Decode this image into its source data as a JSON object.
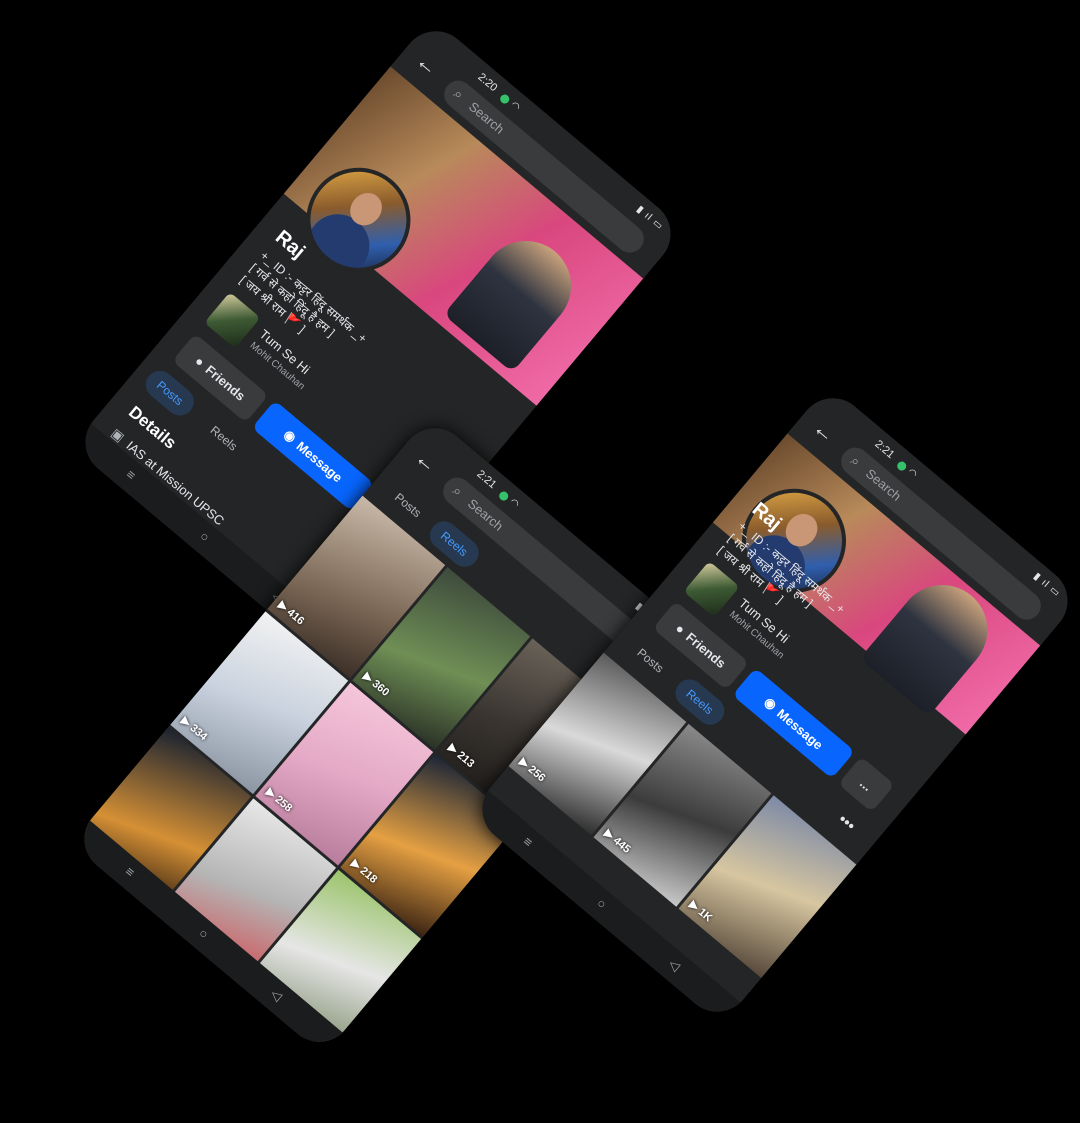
{
  "phones": {
    "profile": {
      "status": {
        "time": "2:20"
      },
      "search": {
        "placeholder": "Search"
      },
      "profile": {
        "name": "Raj",
        "bio": [
          "+_ ID :- कट्टर हिंदू समर्थक _+",
          "[ गर्व से कहो हिंदू है हम ]",
          "[ जय श्री राम 🚩 ]"
        ],
        "music": {
          "title": "Tum Se Hi",
          "artist": "Mohit Chauhan"
        }
      },
      "buttons": {
        "friends": "Friends",
        "message": "Message",
        "more": "..."
      },
      "tabs": {
        "posts": "Posts",
        "reels": "Reels"
      },
      "details": {
        "title": "Details",
        "work": "IAS at Mission UPSC"
      },
      "nav": {
        "menu": "≡",
        "home": "○",
        "back": "◁"
      }
    },
    "reels": {
      "status": {
        "time": "2:21"
      },
      "search": {
        "placeholder": "Search"
      },
      "tabs": {
        "posts": "Posts",
        "reels": "Reels"
      },
      "reels": [
        {
          "count": "416"
        },
        {
          "count": "360"
        },
        {
          "count": "213"
        },
        {
          "count": "334"
        },
        {
          "count": "258"
        },
        {
          "count": "218"
        }
      ],
      "nav": {
        "menu": "≡",
        "home": "○",
        "back": "◁"
      }
    },
    "profile_reels": {
      "status": {
        "time": "2:21"
      },
      "search": {
        "placeholder": "Search"
      },
      "profile": {
        "name": "Raj",
        "bio": [
          "+_ ID :- कट्टर हिंदू समर्थक _+",
          "[ गर्व से कहो हिंदू है हम ]",
          "[ जय श्री राम 🚩 ]"
        ],
        "music": {
          "title": "Tum Se Hi",
          "artist": "Mohit Chauhan"
        }
      },
      "buttons": {
        "friends": "Friends",
        "message": "Message",
        "more": "..."
      },
      "tabs": {
        "posts": "Posts",
        "reels": "Reels"
      },
      "reels": [
        {
          "count": "256"
        },
        {
          "count": "445"
        },
        {
          "count": "1K"
        }
      ],
      "nav": {
        "menu": "≡",
        "home": "○",
        "back": "◁"
      }
    }
  },
  "icons": {
    "back": "arrow-left-icon",
    "search": "search-icon",
    "friends": "person-icon",
    "messenger": "messenger-icon",
    "play": "play-icon"
  },
  "colors": {
    "background": "#000000",
    "surface": "#242526",
    "accent": "#0866ff",
    "tab_active_bg": "#263951",
    "tab_active_text": "#4599ff"
  }
}
